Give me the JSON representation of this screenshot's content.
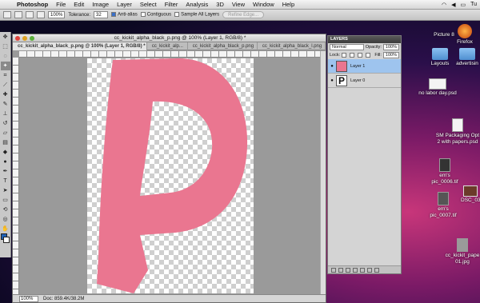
{
  "menubar": {
    "apple": "",
    "items": [
      "Photoshop",
      "File",
      "Edit",
      "Image",
      "Layer",
      "Select",
      "Filter",
      "Analysis",
      "3D",
      "View",
      "Window",
      "Help"
    ],
    "day": "Tu",
    "title_right": "MY FAVORI"
  },
  "options": {
    "zoom": "100%",
    "tolerance_label": "Tolerance:",
    "tolerance_value": "32",
    "antialias": "Anti-alias",
    "contiguous": "Contiguous",
    "sample_all": "Sample All Layers",
    "refine_edge": "Refine Edge..."
  },
  "document": {
    "title": "cc_kickit_alpha_black_p.png @ 100% (Layer 1, RGB/8) *",
    "tabs": [
      "cc_kickit_alpha_black_p.png @ 100% (Layer 1, RGB/8) *",
      "cc_kickit_alp...",
      "cc_kickit_alpha_black_p.png",
      "cc_kickit_alpha_black_l.png"
    ],
    "zoom": "100%",
    "doc_info": "Doc: 859.4K/38.2M",
    "letter_color": "#ea7690"
  },
  "layers": {
    "title": "LAYERS",
    "blend_mode": "Normal",
    "opacity_label": "Opacity:",
    "opacity": "100%",
    "lock_label": "Lock:",
    "fill_label": "Fill:",
    "fill": "100%",
    "items": [
      {
        "name": "Layer 1",
        "active": true
      },
      {
        "name": "Layer 0",
        "active": false
      }
    ]
  },
  "desktop": {
    "icons": [
      {
        "label": "Picture 8"
      },
      {
        "label": "Firefox"
      },
      {
        "label": "Layouts"
      },
      {
        "label": "advertisin"
      },
      {
        "label": "no labor day.psd"
      },
      {
        "label": "SM Packaging Opt 2 with papers.psd"
      },
      {
        "label": "em's pic_0006.tif"
      },
      {
        "label": "DSC_0393"
      },
      {
        "label": "em's pic_0007.tif"
      },
      {
        "label": "cc_kickit_pape 01.jpg"
      }
    ]
  }
}
